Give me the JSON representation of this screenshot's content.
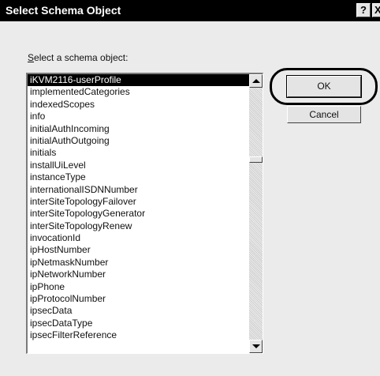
{
  "window": {
    "title": "Select Schema Object",
    "help_button": "?",
    "close_button": "X"
  },
  "prompt": {
    "accel": "S",
    "rest": "elect a schema object:"
  },
  "list": {
    "selected_index": 0,
    "items": [
      "iKVM2116-userProfile",
      "implementedCategories",
      "indexedScopes",
      "info",
      "initialAuthIncoming",
      "initialAuthOutgoing",
      "initials",
      "installUiLevel",
      "instanceType",
      "internationalISDNNumber",
      "interSiteTopologyFailover",
      "interSiteTopologyGenerator",
      "interSiteTopologyRenew",
      "invocationId",
      "ipHostNumber",
      "ipNetmaskNumber",
      "ipNetworkNumber",
      "ipPhone",
      "ipProtocolNumber",
      "ipsecData",
      "ipsecDataType",
      "ipsecFilterReference"
    ]
  },
  "buttons": {
    "ok": "OK",
    "cancel": "Cancel"
  }
}
